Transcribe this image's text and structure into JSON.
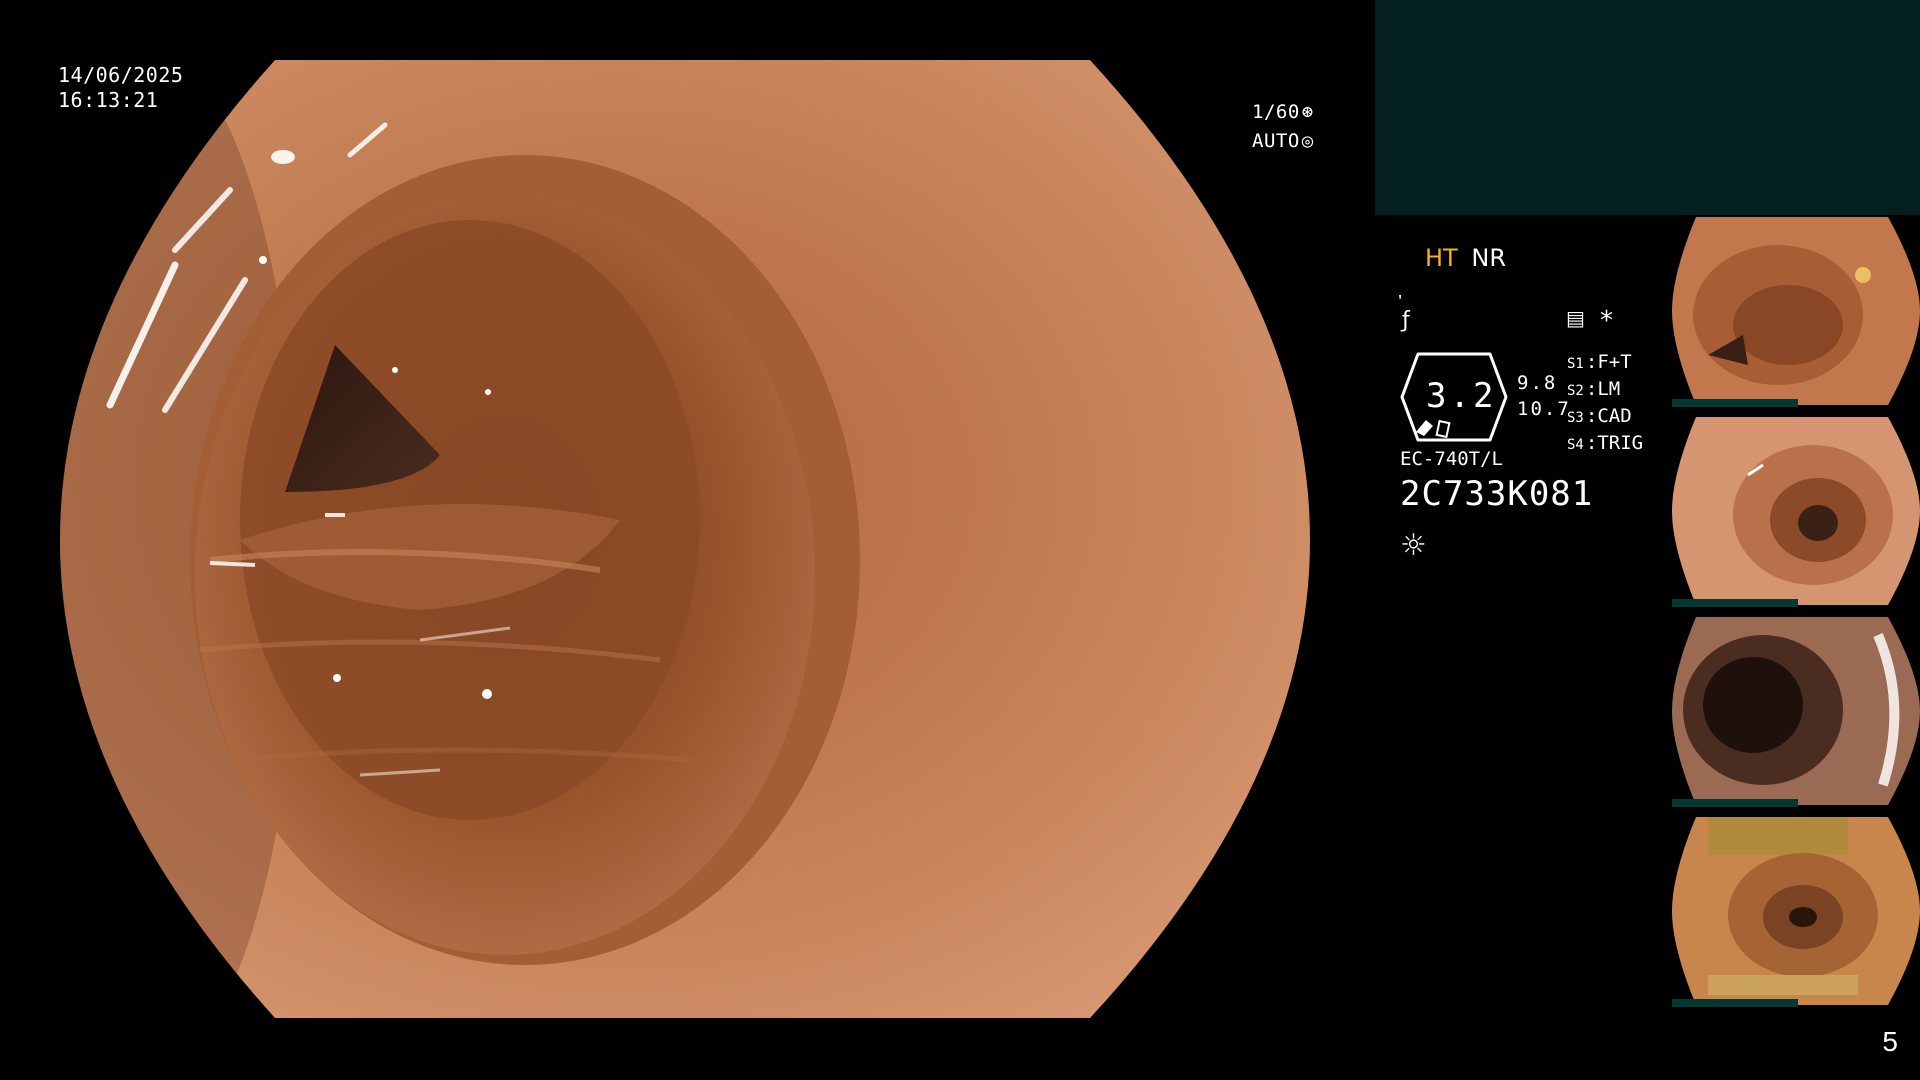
{
  "main_view": {
    "date": "14/06/2025",
    "time": "16:13:21",
    "shutter": "1/60",
    "exposure": "AUTO"
  },
  "right_panel": {
    "mode_ht": "HT",
    "mode_nr": "NR",
    "zoom_value": "3.2",
    "side_value_1": "9.8",
    "side_value_2": "10.7",
    "switches": [
      {
        "key": "S1",
        "value": "F+T"
      },
      {
        "key": "S2",
        "value": "LM"
      },
      {
        "key": "S3",
        "value": "CAD"
      },
      {
        "key": "S4",
        "value": "TRIG"
      }
    ],
    "model": "EC-740T/L",
    "serial": "2C733K081",
    "asterisk": "*"
  },
  "thumbnails": [
    {
      "label": "thumbnail-1"
    },
    {
      "label": "thumbnail-2"
    },
    {
      "label": "thumbnail-3"
    },
    {
      "label": "thumbnail-4"
    }
  ],
  "page_number": "5",
  "colors": {
    "ht_accent": "#f7b21c",
    "panel_teal": "#03201f",
    "tissue": "#c07a4d"
  }
}
